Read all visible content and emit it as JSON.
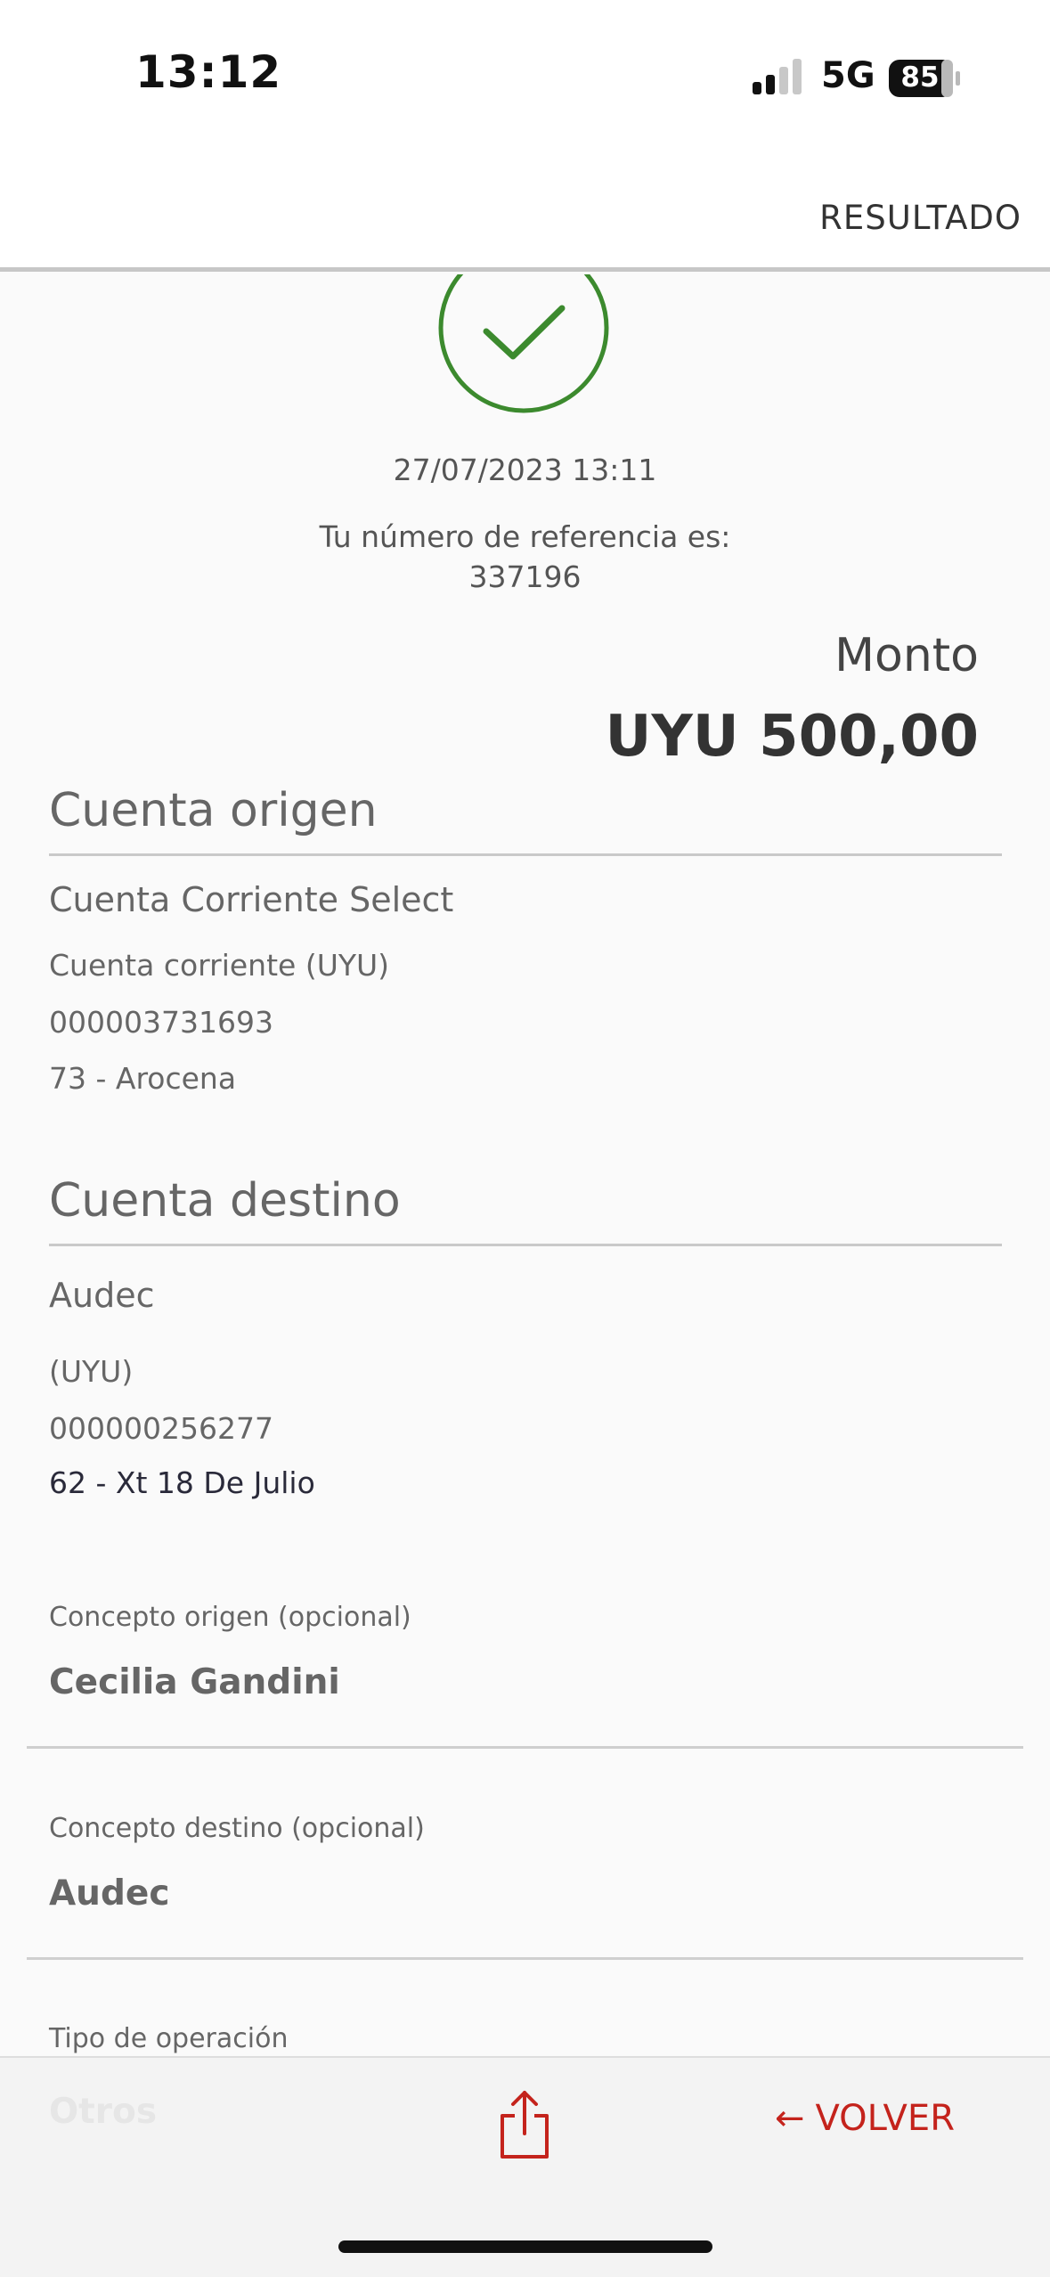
{
  "status_bar": {
    "time": "13:12",
    "network": "5G",
    "battery_level": "85",
    "signal_bars_active": 2,
    "signal_bars_total": 4
  },
  "header": {
    "title": "RESULTADO"
  },
  "result": {
    "status_icon": "check-circle-icon",
    "status_color": "#3c8a2e",
    "date": "27/07/2023 13:11",
    "reference_label": "Tu número de referencia es:",
    "reference_number": "337196",
    "amount_label": "Monto",
    "amount_value": "UYU 500,00"
  },
  "origin": {
    "title": "Cuenta origen",
    "account_name": "Cuenta Corriente Select",
    "account_type": "Cuenta corriente (UYU)",
    "account_number": "000003731693",
    "branch": "73 - Arocena"
  },
  "destination": {
    "title": "Cuenta destino",
    "account_name": "Audec",
    "currency": "(UYU)",
    "account_number": "000000256277",
    "branch": "62 - Xt 18 De Julio"
  },
  "fields": {
    "concept_origin_label": "Concepto origen (opcional)",
    "concept_origin_value": "Cecilia Gandini",
    "concept_destination_label": "Concepto destino (opcional)",
    "concept_destination_value": "Audec",
    "operation_type_label": "Tipo de operación",
    "operation_type_value": "Otros"
  },
  "bottom_bar": {
    "share_icon": "share-icon",
    "back_label": "VOLVER",
    "back_arrow": "←",
    "accent_color": "#c4231c"
  }
}
